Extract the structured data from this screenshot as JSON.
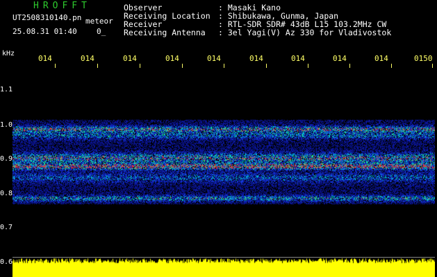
{
  "app_title": "HROFFT",
  "file_name": "UT2508310140.pn",
  "meteor_label": "meteor",
  "date_time": "25.08.31 01:40",
  "truncated_value": "0_",
  "info": [
    {
      "label": "Observer",
      "value": ": Masaki Kano"
    },
    {
      "label": "Receiving Location",
      "value": ": Shibukawa, Gunma, Japan"
    },
    {
      "label": "Receiver",
      "value": ": RTL-SDR SDR# 43dB L15 103.2MHz CW"
    },
    {
      "label": "Receiving Antenna",
      "value": ": 3el Yagi(V) Az 330 for Vladivostok"
    }
  ],
  "time_ticks": [
    "014",
    "014",
    "014",
    "014",
    "014",
    "014",
    "014",
    "014",
    "014",
    "0150"
  ],
  "freq_unit": "kHz",
  "freq_ticks": [
    "1.1",
    "1.0",
    "0.9",
    "0.8",
    "0.7",
    "0.6"
  ],
  "colors": {
    "title": "#2ecc2e",
    "ticks": "#ffff66",
    "noise_low": "#0a1a9a",
    "noise_mid": "#00c8c8",
    "noise_high": "#e04040",
    "band": "#ffff00"
  }
}
